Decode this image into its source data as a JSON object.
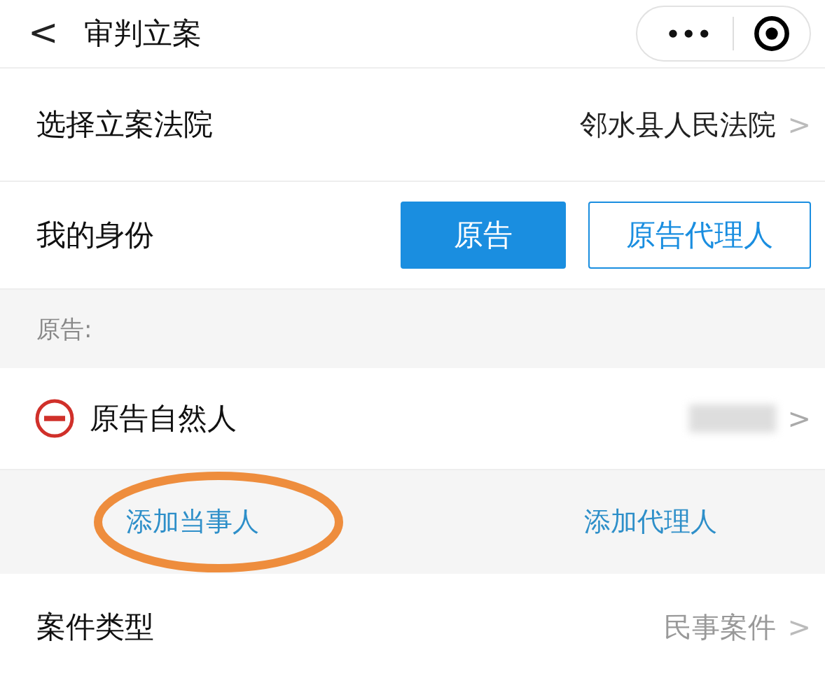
{
  "header": {
    "back": "<",
    "title": "审判立案",
    "more": "•••"
  },
  "court": {
    "label": "选择立案法院",
    "value": "邻水县人民法院",
    "chevron": ">"
  },
  "identity": {
    "label": "我的身份",
    "options": [
      {
        "label": "原告",
        "selected": true
      },
      {
        "label": "原告代理人",
        "selected": false
      }
    ]
  },
  "section_label": "原告:",
  "party": {
    "name": "原告自然人",
    "redacted": true,
    "chevron": ">"
  },
  "actions": [
    {
      "label": "添加当事人",
      "circled": true
    },
    {
      "label": "添加代理人",
      "circled": false
    }
  ],
  "case_type": {
    "label": "案件类型",
    "value": "民事案件",
    "chevron": ">"
  }
}
